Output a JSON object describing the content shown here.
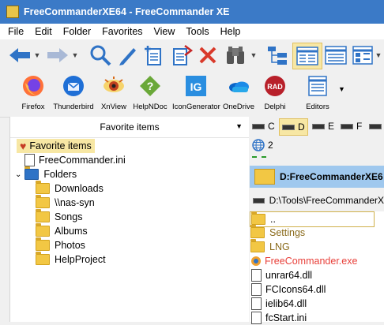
{
  "window": {
    "title": "FreeCommanderXE64 - FreeCommander XE"
  },
  "menu": [
    "File",
    "Edit",
    "Folder",
    "Favorites",
    "View",
    "Tools",
    "Help"
  ],
  "favorites_toolbar": [
    {
      "label": "Firefox",
      "icon": "firefox-icon"
    },
    {
      "label": "Thunderbird",
      "icon": "thunderbird-icon"
    },
    {
      "label": "XnView",
      "icon": "xnview-icon"
    },
    {
      "label": "HelpNDoc",
      "icon": "helpndoc-icon"
    },
    {
      "label": "IconGenerator",
      "icon": "icongenerator-icon"
    },
    {
      "label": "OneDrive",
      "icon": "onedrive-icon"
    },
    {
      "label": "Delphi",
      "icon": "delphi-icon"
    },
    {
      "label": "Editors",
      "icon": "editors-icon"
    }
  ],
  "left_panel": {
    "header": "Favorite items",
    "tree": [
      {
        "label": "Favorite items",
        "type": "heart",
        "selected": true
      },
      {
        "label": "FreeCommander.ini",
        "type": "file"
      },
      {
        "label": "Folders",
        "type": "folder-open"
      },
      {
        "label": "Downloads",
        "type": "folder"
      },
      {
        "label": "\\\\nas-syn",
        "type": "folder"
      },
      {
        "label": "Songs",
        "type": "folder"
      },
      {
        "label": "Albums",
        "type": "folder"
      },
      {
        "label": "Photos",
        "type": "folder"
      },
      {
        "label": "HelpProject",
        "type": "folder"
      }
    ]
  },
  "right_panel": {
    "drives": [
      "C",
      "D",
      "E",
      "F"
    ],
    "network": "2",
    "current_folder": "D:FreeCommanderXE6",
    "path": "D:\\Tools\\FreeCommanderX",
    "files": [
      {
        "name": "..",
        "type": "folder",
        "color": "#000000"
      },
      {
        "name": "Settings",
        "type": "folder",
        "color": "#8a6a1a"
      },
      {
        "name": "LNG",
        "type": "folder",
        "color": "#8a6a1a"
      },
      {
        "name": "FreeCommander.exe",
        "type": "exe",
        "color": "#e8403a"
      },
      {
        "name": "unrar64.dll",
        "type": "file",
        "color": "#000000"
      },
      {
        "name": "FCIcons64.dll",
        "type": "file",
        "color": "#000000"
      },
      {
        "name": "ielib64.dll",
        "type": "file",
        "color": "#000000"
      },
      {
        "name": "fcStart.ini",
        "type": "file",
        "color": "#000000"
      }
    ]
  }
}
